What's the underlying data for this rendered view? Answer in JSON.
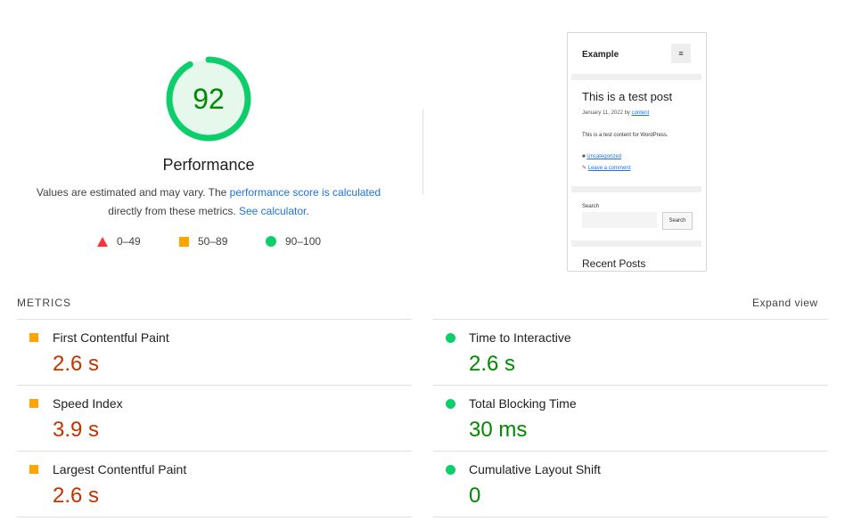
{
  "score": {
    "value": "92",
    "fraction": 0.92,
    "label": "Performance"
  },
  "description": {
    "text1": "Values are estimated and may vary. The ",
    "link1": "performance score is calculated",
    "text2": "directly from these metrics. ",
    "link2": "See calculator",
    "text3": "."
  },
  "legend": {
    "fail": "0–49",
    "average": "50–89",
    "pass": "90–100"
  },
  "thumbnail": {
    "site_title": "Example",
    "menu_glyph": "≡",
    "post_title": "This is a test post",
    "meta_date": "January 11, 2022 by ",
    "meta_author": "content",
    "body": "This is a test content for WordPress.",
    "category": "Uncategorized",
    "comment": "Leave a comment",
    "search_label": "Search",
    "search_button": "Search",
    "recent": "Recent Posts"
  },
  "metrics": {
    "header": "METRICS",
    "expand": "Expand view",
    "items": [
      {
        "name": "First Contentful Paint",
        "value": "2.6 s",
        "status": "average"
      },
      {
        "name": "Time to Interactive",
        "value": "2.6 s",
        "status": "pass"
      },
      {
        "name": "Speed Index",
        "value": "3.9 s",
        "status": "average"
      },
      {
        "name": "Total Blocking Time",
        "value": "30 ms",
        "status": "pass"
      },
      {
        "name": "Largest Contentful Paint",
        "value": "2.6 s",
        "status": "average"
      },
      {
        "name": "Cumulative Layout Shift",
        "value": "0",
        "status": "pass"
      }
    ]
  },
  "colors": {
    "pass": "#0cce6b",
    "average": "#ffa400",
    "fail": "#ff3333",
    "pass_text": "#008800",
    "average_text": "#c33300",
    "link": "#1a73e8"
  }
}
